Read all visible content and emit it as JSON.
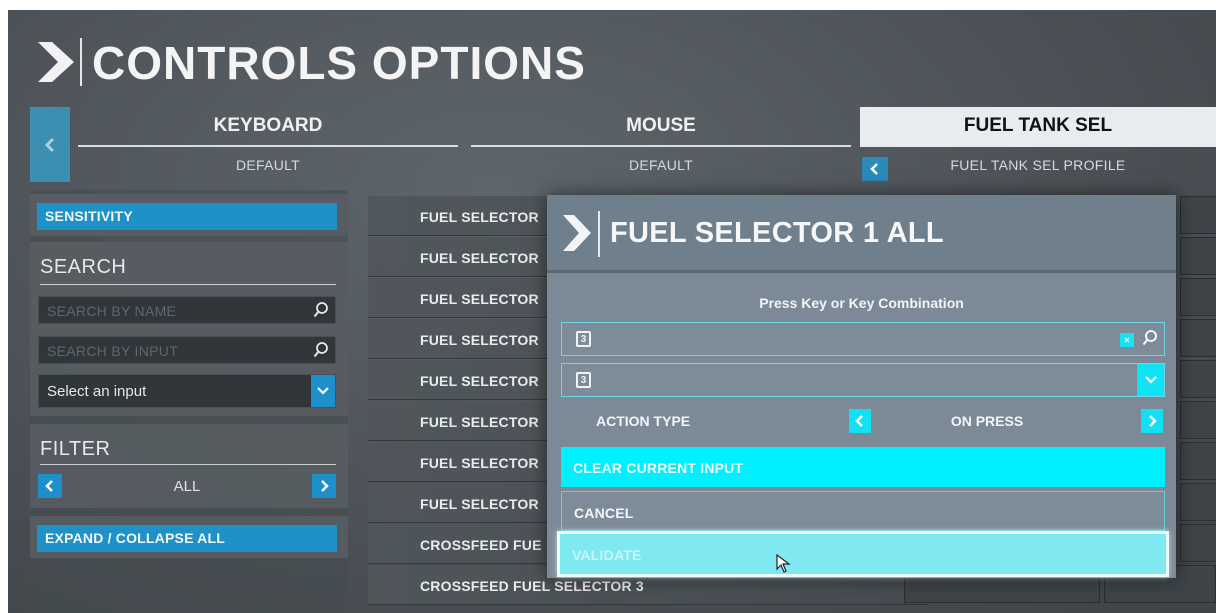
{
  "header": {
    "title": "CONTROLS OPTIONS"
  },
  "tabs": [
    {
      "name": "KEYBOARD",
      "sub": "DEFAULT"
    },
    {
      "name": "MOUSE",
      "sub": "DEFAULT"
    },
    {
      "name": "FUEL TANK SEL",
      "sub": "FUEL TANK SEL PROFILE"
    }
  ],
  "sidebar": {
    "sensitivity": "SENSITIVITY",
    "search_title": "SEARCH",
    "search_by_name": "SEARCH BY NAME",
    "search_by_input": "SEARCH BY INPUT",
    "select_input": "Select an input",
    "filter_title": "FILTER",
    "filter_value": "ALL",
    "expand_collapse": "EXPAND / COLLAPSE ALL"
  },
  "list": {
    "rows": [
      "FUEL SELECTOR",
      "FUEL SELECTOR",
      "FUEL SELECTOR",
      "FUEL SELECTOR",
      "FUEL SELECTOR",
      "FUEL SELECTOR",
      "FUEL SELECTOR",
      "FUEL SELECTOR",
      "CROSSFEED FUE",
      "CROSSFEED FUEL SELECTOR 3"
    ]
  },
  "dialog": {
    "title": "FUEL SELECTOR 1 ALL",
    "prompt": "Press Key or Key Combination",
    "key1": "3",
    "key2": "3",
    "clear_x": "×",
    "action_type_label": "ACTION TYPE",
    "action_type_value": "ON PRESS",
    "clear_button": "CLEAR CURRENT INPUT",
    "cancel_button": "CANCEL",
    "validate_button": "VALIDATE"
  },
  "colors": {
    "accent_blue": "#1d8fca",
    "cyan": "#00f0ff",
    "dialog_bg": "#7b8a96"
  }
}
